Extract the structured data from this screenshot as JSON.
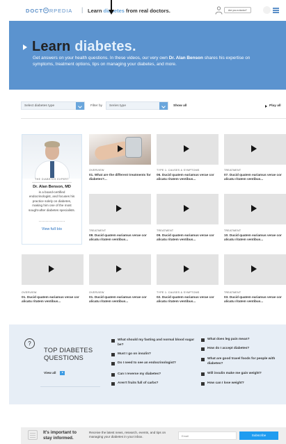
{
  "header": {
    "logo_a": "DOCT",
    "logo_b": "RPEDIA",
    "separator": "|",
    "tagline_prefix": "Learn ",
    "tagline_accent": "diabetes",
    "tagline_suffix": " from real doctors.",
    "doctor_badge": "Are you a doctor?",
    "accent_color": "#5b8fc8"
  },
  "hero": {
    "title_a": "Learn ",
    "title_b": "diabetes.",
    "desc_a": "Get answers on your health questions. In these videos, our very own ",
    "desc_name": "Dr. Alan Benson",
    "desc_b": " shares his expertise on symptoms, treatment options, tips on managing your diabetes, and more.",
    "bg_color": "#5b93cf"
  },
  "filters": {
    "type_select": "Select diabetes type",
    "filter_label": "Filter by",
    "series_select": "Series type",
    "show_all": "Show all",
    "play_all": "Play all"
  },
  "expert": {
    "label": "THE DIABETES EXPERT",
    "name": "Dr. Alan Benson, MD",
    "bio": "is a board-certified endocrinologist, and focuses his practice solely on diabetes, making him one of the most sought-after diabetes specialists.",
    "link": "View full bio"
  },
  "videos": [
    {
      "category": "OVERVIEW",
      "title": "01. What are the different treatments for diabetes?..."
    },
    {
      "category": "TYPE 1: CAUSES & SYMPTOMS",
      "title": "06. Ducid quatem eariamus verae cor alicatu ritatem ventibus..."
    },
    {
      "category": "TREATMENT",
      "title": "07. Ducid quatem eariamus verae cor alicatu ritatem ventibus..."
    },
    {
      "category": "TREATMENT",
      "title": "08. Ducid quatem eariamus verae cor alicatu ritatem ventibus..."
    },
    {
      "category": "TREATMENT",
      "title": "09. Ducid quatem eariamus verae cor alicatu ritatem ventibus..."
    },
    {
      "category": "TREATMENT",
      "title": "10. Ducid quatem eariamus verae cor alicatu ritatem ventibus..."
    },
    {
      "category": "OVERVIEW",
      "title": "01. Ducid quatem eariamus verae cor alicatu ritatem ventibus..."
    },
    {
      "category": "OVERVIEW",
      "title": "01. Ducid quatem eariamus verae cor alicatu ritatem ventibus..."
    },
    {
      "category": "TYPE 1: CAUSES & SYMPTOMS",
      "title": "02. Ducid quatem eariamus verae cor alicatu ritatem ventibus..."
    },
    {
      "category": "TREATMENT",
      "title": "03. Ducid quatem eariamus verae cor alicatu ritatem ventibus..."
    }
  ],
  "questions": {
    "icon": "?",
    "heading": "TOP DIABETES QUESTIONS",
    "view_all": "View all",
    "left": [
      "What should my fasting and normal blood sugar be?",
      "Must I go on insulin?",
      "Do I need to see an endocrinologist?",
      "Can I reverse my diabetes?",
      "Aren't fruits full of carbs?"
    ],
    "right": [
      "What does leg pain mean?",
      "How do I accept diabetes?",
      "What are good travel foods for people with diabetes?",
      "Will insulin make me gain weight?",
      "How can I lose weight?"
    ]
  },
  "newsletter": {
    "heading": "It's important to stay informed.",
    "text": "Receive the latest news, research, events, and tips on managing your diabetes in your inbox.",
    "email_placeholder": "Email",
    "subscribe": "Subscribe",
    "button_color": "#1f9cf0"
  }
}
